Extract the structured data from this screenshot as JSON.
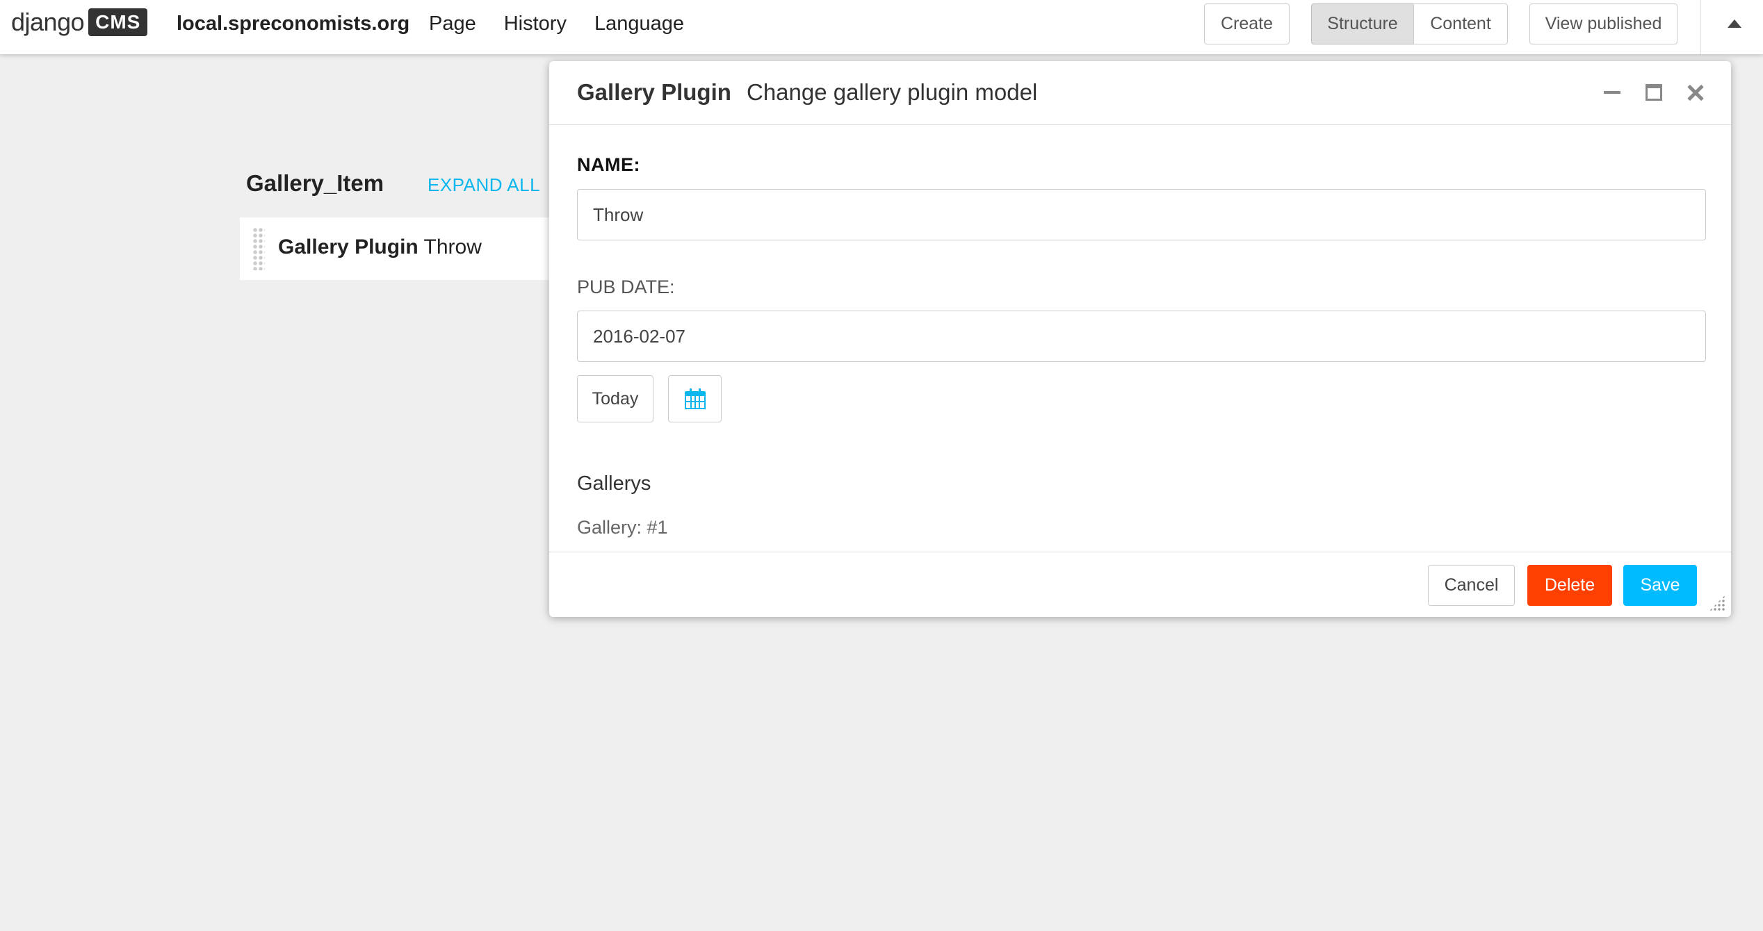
{
  "toolbar": {
    "logo_django": "django",
    "logo_cms": "CMS",
    "site_name": "local.spreconomists.org",
    "menu": [
      "Page",
      "History",
      "Language"
    ],
    "buttons": {
      "create": "Create",
      "structure": "Structure",
      "content": "Content",
      "view_published": "View published"
    },
    "collapse_icon": "caret-up-icon"
  },
  "structure_board": {
    "placeholder_title": "Gallery_Item",
    "expand_all": "EXPAND ALL",
    "plugin": {
      "type": "Gallery Plugin",
      "name": "Throw"
    }
  },
  "modal": {
    "title": "Gallery Plugin",
    "subtitle": "Change gallery plugin model",
    "controls": [
      "minimize-icon",
      "maximize-icon",
      "close-icon"
    ],
    "fields": {
      "name_label": "NAME:",
      "name_value": "Throw",
      "pub_date_label": "PUB DATE:",
      "pub_date_value": "2016-02-07",
      "today_button": "Today",
      "calendar_icon": "calendar-icon"
    },
    "inline": {
      "section_title": "Gallerys",
      "item_label": "Gallery: #1"
    },
    "footer": {
      "cancel": "Cancel",
      "delete": "Delete",
      "save": "Save"
    }
  },
  "colors": {
    "accent_blue": "#0bb6ef",
    "delete_red": "#ff4000",
    "save_blue": "#00bbff",
    "background": "#efefef"
  }
}
